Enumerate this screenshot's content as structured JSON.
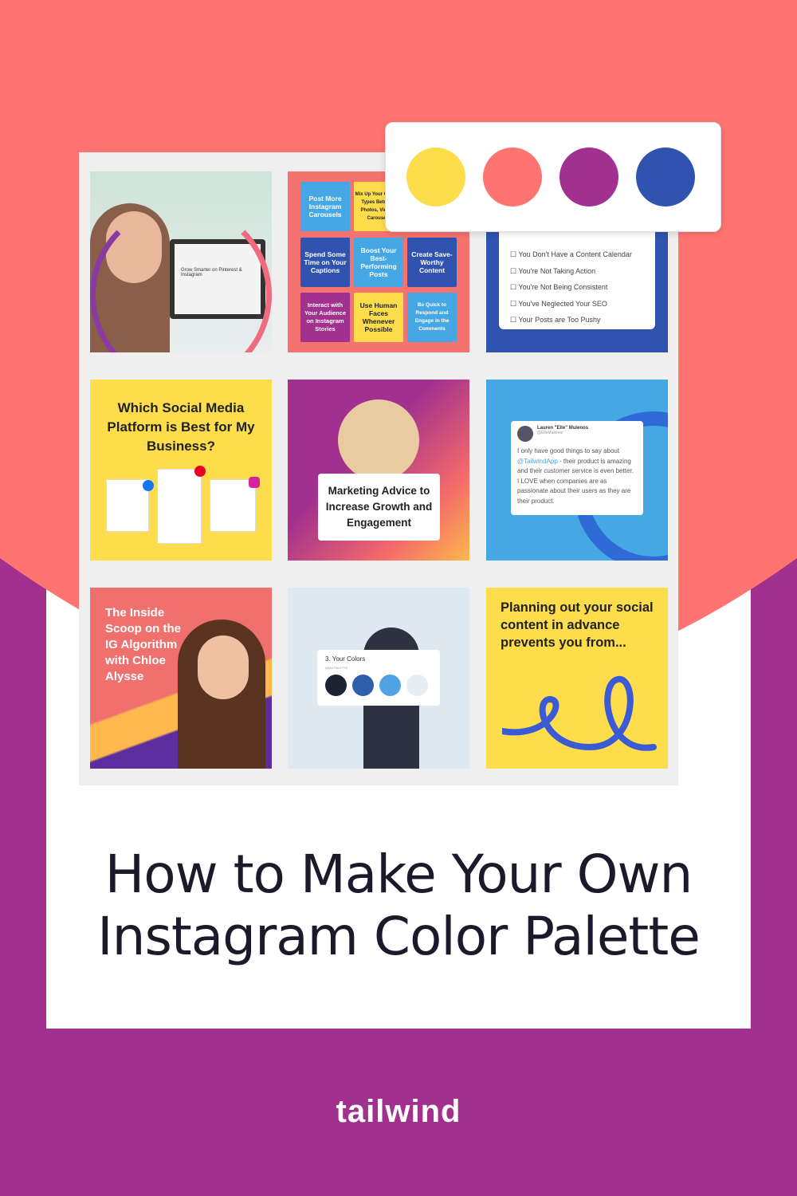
{
  "colors": {
    "coral": "#FF7470",
    "purple": "#A1308E",
    "yellow": "#FEDD4D",
    "blue": "#2F53AE"
  },
  "palette": [
    "#FEDD4D",
    "#FF7470",
    "#A1308E",
    "#2F53AE"
  ],
  "tiles": {
    "t1": {
      "laptop_text": "Grow Smarter on Pinterest & Instagram"
    },
    "t2": {
      "notes": [
        "Post More Instagram Carousels",
        "Mix Up Your Content Types Between Photos, Videos, Carousels",
        "Spend Some Time on Your Captions",
        "Boost Your Best-Performing Posts",
        "Create Save-Worthy Content",
        "Interact with Your Audience on Instagram Stories",
        "Use Human Faces Whenever Possible",
        "Be Quick to Respond and Engage in the Comments"
      ]
    },
    "t3": {
      "items": [
        "You Don't Have a Content Calendar",
        "You're Not Taking Action",
        "You're Not Being Consistent",
        "You've Neglected Your SEO",
        "Your Posts are Too Pushy"
      ]
    },
    "t4": {
      "heading": "Which Social Media Platform is Best for My Business?"
    },
    "t5": {
      "caption": "Marketing Advice to Increase Growth and Engagement"
    },
    "t6": {
      "name": "Lauren \"Elle\" Mulenos",
      "handle": "@ElleMulenos",
      "mention": "@TailwindApp",
      "text": " - their product is amazing and their customer service is even better. I LOVE when companies are as passionate about their users as they are their product.",
      "lead": "I only have good things to say about "
    },
    "t7": {
      "text": "The Inside Scoop on the IG Algorithm with Chloe Alysse"
    },
    "t8": {
      "heading": "3. Your Colors",
      "sub": "MAIN PALETTE",
      "swatches": [
        "#1C2333",
        "#2F5FA8",
        "#4FA3E3",
        "#E4EEF6"
      ]
    },
    "t9": {
      "text": "Planning out your social content in advance prevents you from..."
    }
  },
  "title": "How to Make Your Own Instagram Color Palette",
  "logo": "tailwind"
}
